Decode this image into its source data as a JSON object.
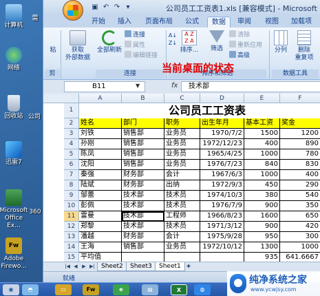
{
  "desktop": {
    "icons": [
      {
        "label": "计算机",
        "icon": "computer-icon"
      },
      {
        "label": "网络",
        "icon": "network-icon"
      },
      {
        "label": "回收站",
        "icon": "recycle-bin-icon"
      },
      {
        "label": "迅雷7",
        "icon": "thunder-icon"
      },
      {
        "label": "Microsoft Office Ex...",
        "icon": "excel-shortcut-icon"
      },
      {
        "label": "Adobe Firewo...",
        "icon": "fireworks-icon"
      }
    ],
    "partial_labels": [
      "需",
      "公司",
      "360"
    ],
    "browser_fragments": [
      "标",
      "1、",
      "H1",
      "2、",
      "<i",
      "xi",
      "3、",
      "<i",
      "xi",
      "<i",
      "xi",
      "<i",
      "xi",
      "<i",
      "xi",
      "字数"
    ]
  },
  "excel": {
    "title": "公司员工工资表1.xls [兼容模式] - Microsoft Excel",
    "tabs": [
      "开始",
      "插入",
      "页面布局",
      "公式",
      "数据",
      "审阅",
      "视图",
      "加载项"
    ],
    "active_tab": "数据",
    "ribbon": {
      "get_external": "获取\n外部数据",
      "refresh_all": "全部刷新",
      "connections": "连接",
      "properties": "属性",
      "edit_links": "编辑链接",
      "group_connections": "连接",
      "sort": "排序...",
      "filter": "筛选",
      "clear": "清除",
      "reapply": "重新应用",
      "advanced": "高级",
      "group_sort_filter": "排序和筛选",
      "text_to_columns": "分列",
      "remove_dup": "删除\n重复项",
      "group_data_tools": "数据工具",
      "group_left_cut": "剪",
      "paste_cut": "粘"
    },
    "annotation": "当前桌面的状态",
    "name_box": "B11",
    "formula_fx": "fx",
    "formula_value": "技术部",
    "columns": [
      "A",
      "B",
      "C",
      "D",
      "E",
      "F"
    ],
    "sheet_title": "公司员工工资表",
    "headers": [
      "姓名",
      "部门",
      "职务",
      "出生年月",
      "基本工资",
      "奖金"
    ],
    "rows": [
      [
        "刘铁",
        "销售部",
        "业务员",
        "1970/7/2",
        "1500",
        "1200"
      ],
      [
        "孙刚",
        "销售部",
        "业务员",
        "1972/12/23",
        "400",
        "890"
      ],
      [
        "陈凤",
        "销售部",
        "业务员",
        "1965/4/25",
        "1000",
        "780"
      ],
      [
        "沈阳",
        "销售部",
        "业务员",
        "1976/7/23",
        "840",
        "830"
      ],
      [
        "秦强",
        "财务部",
        "会计",
        "1967/6/3",
        "1000",
        "400"
      ],
      [
        "陆斌",
        "财务部",
        "出纳",
        "1972/9/3",
        "450",
        "290"
      ],
      [
        "邹蕾",
        "技术部",
        "技术员",
        "1974/10/3",
        "380",
        "540"
      ],
      [
        "彭佩",
        "技术部",
        "技术员",
        "1976/7/9",
        "900",
        "350"
      ],
      [
        "雷曼",
        "技术部",
        "工程师",
        "1966/8/23",
        "1600",
        "650"
      ],
      [
        "郑黎",
        "技术部",
        "技术员",
        "1971/3/12",
        "900",
        "420"
      ],
      [
        "潘越",
        "财务部",
        "会计",
        "1975/9/28",
        "950",
        "300"
      ],
      [
        "王海",
        "销售部",
        "业务员",
        "1972/10/12",
        "1300",
        "1000"
      ],
      [
        "平均值",
        "",
        "",
        "",
        "935",
        "641.6667"
      ]
    ],
    "row_numbers": [
      "1",
      "2",
      "3",
      "4",
      "5",
      "6",
      "7",
      "8",
      "9",
      "10",
      "11",
      "12",
      "13",
      "14",
      "15",
      "16"
    ],
    "sheet_tabs": [
      "Sheet2",
      "Sheet3",
      "Sheet1"
    ],
    "active_sheet": "Sheet1",
    "status": "就绪"
  },
  "watermark": {
    "title": "纯净系统之家",
    "url": "www.ycwjsy.com"
  },
  "colors": {
    "header_fill": "#ffff00",
    "ribbon_text": "#15428b",
    "annotation": "#e00000"
  }
}
